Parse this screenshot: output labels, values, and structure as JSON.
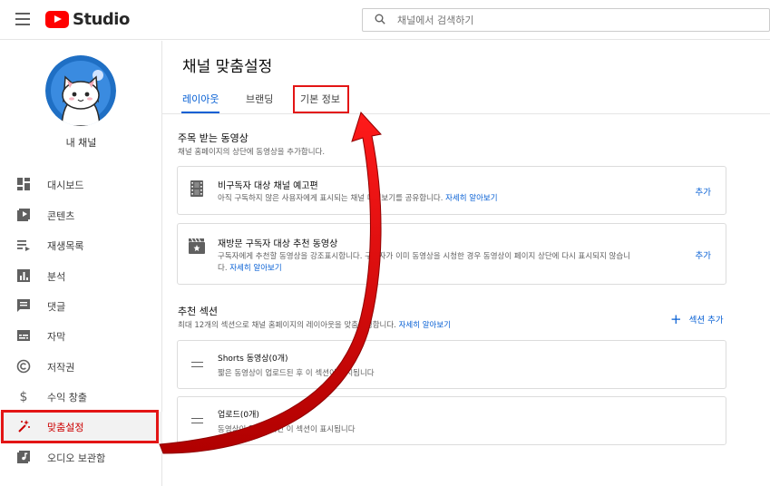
{
  "app": {
    "logo_text": "Studio",
    "brand_color": "#ff0000",
    "accent": "#065fd4",
    "annotation_color": "#e31515"
  },
  "search": {
    "placeholder": "채널에서 검색하기"
  },
  "channel": {
    "label": "내 채널"
  },
  "sidebar": {
    "items": [
      {
        "label": "대시보드",
        "icon": "dashboard-icon"
      },
      {
        "label": "콘텐츠",
        "icon": "content-icon"
      },
      {
        "label": "재생목록",
        "icon": "playlist-icon"
      },
      {
        "label": "분석",
        "icon": "analytics-icon"
      },
      {
        "label": "댓글",
        "icon": "comments-icon"
      },
      {
        "label": "자막",
        "icon": "subtitles-icon"
      },
      {
        "label": "저작권",
        "icon": "copyright-icon"
      },
      {
        "label": "수익 창출",
        "icon": "dollar-icon"
      },
      {
        "label": "맞춤설정",
        "icon": "magic-wand-icon",
        "active": true
      },
      {
        "label": "오디오 보관함",
        "icon": "audio-library-icon"
      }
    ]
  },
  "main": {
    "title": "채널 맞춤설정",
    "tabs": [
      {
        "label": "레이아웃",
        "active": true
      },
      {
        "label": "브랜딩"
      },
      {
        "label": "기본 정보"
      }
    ],
    "featured": {
      "title": "주목 받는 동영상",
      "desc": "채널 홈페이지의 상단에 동영상을 추가합니다.",
      "cards": [
        {
          "title": "비구독자 대상 채널 예고편",
          "desc": "아직 구독하지 않은 사용자에게 표시되는 채널 미리보기를 공유합니다.",
          "link": "자세히 알아보기",
          "action": "추가",
          "icon": "film-icon"
        },
        {
          "title": "재방문 구독자 대상 추천 동영상",
          "desc": "구독자에게 추천할 동영상을 강조표시합니다. 구독자가 이미 동영상을 시청한 경우 동영상이 페이지 상단에 다시 표시되지 않습니",
          "desc2": "다.",
          "link": "자세히 알아보기",
          "action": "추가",
          "icon": "clapperboard-icon"
        }
      ]
    },
    "sections": {
      "title": "추천 섹션",
      "desc": "최대 12개의 섹션으로 채널 홈페이지의 레이아웃을 맞춤설정합니다.",
      "link": "자세히 알아보기",
      "add_label": "섹션 추가",
      "items": [
        {
          "title": "Shorts 동영상(0개)",
          "desc": "짧은 동영상이 업로드된 후 이 섹션이 표시됩니다"
        },
        {
          "title": "업로드(0개)",
          "desc": "동영상이 업로드되면 이 섹션이 표시됩니다"
        }
      ]
    }
  }
}
